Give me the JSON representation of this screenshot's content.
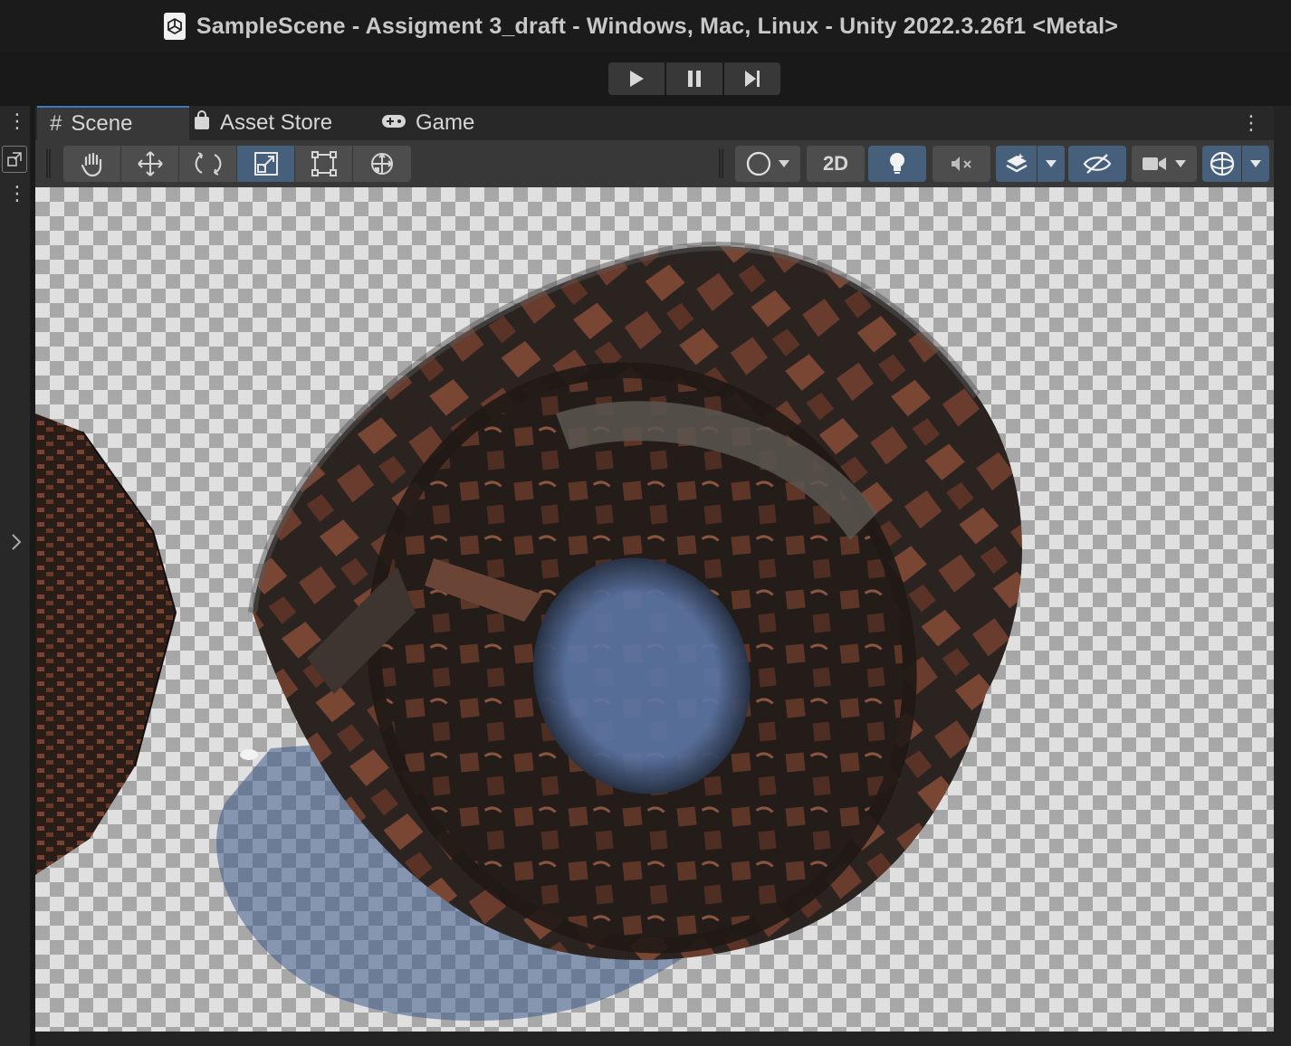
{
  "window": {
    "title": "SampleScene - Assigment 3_draft - Windows, Mac, Linux - Unity 2022.3.26f1 <Metal>",
    "icon": "unity-document-icon"
  },
  "playbar": {
    "buttons": [
      "play-icon",
      "pause-icon",
      "step-icon"
    ]
  },
  "tabs": [
    {
      "label": "Scene",
      "icon": "grid-hash-icon",
      "active": true
    },
    {
      "label": "Asset Store",
      "icon": "shopping-bag-icon",
      "active": false
    },
    {
      "label": "Game",
      "icon": "gamepad-icon",
      "active": false
    }
  ],
  "toolbar": {
    "tools": [
      "hand-tool",
      "move-tool",
      "rotate-tool",
      "scale-tool",
      "rect-tool",
      "transform-tool"
    ],
    "active_tool": "scale-tool",
    "draw_mode_icon": "shaded-sphere-icon",
    "toggle_2d_label": "2D",
    "lighting_on": true,
    "audio_muted": true,
    "effects_on": true,
    "visibility_on": true
  },
  "colors": {
    "accent": "#3a79bb",
    "active_button": "#46607c",
    "panel": "#383838",
    "title_bg": "#1b1b1b"
  },
  "scene": {
    "objects": [
      "patterned-ring-mesh",
      "textured-cube-mesh",
      "shadow"
    ]
  }
}
